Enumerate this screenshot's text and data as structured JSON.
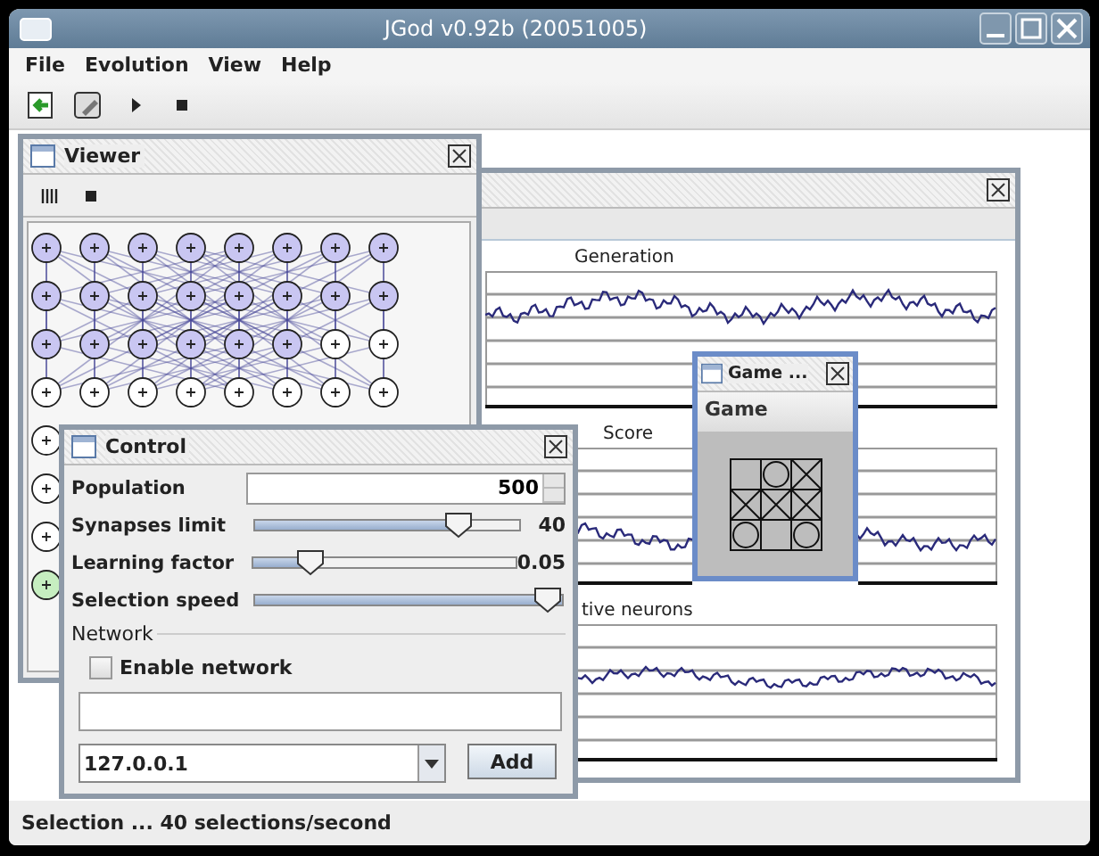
{
  "window": {
    "title": "JGod v0.92b (20051005)"
  },
  "menu": [
    "File",
    "Evolution",
    "View",
    "Help"
  ],
  "viewer": {
    "title": "Viewer",
    "neuron_rows": [
      [
        {
          "active": true,
          "highlighted": false
        },
        {
          "active": true,
          "highlighted": false
        },
        {
          "active": true,
          "highlighted": false
        },
        {
          "active": true,
          "highlighted": false
        },
        {
          "active": true,
          "highlighted": false
        },
        {
          "active": true,
          "highlighted": false
        },
        {
          "active": true,
          "highlighted": false
        },
        {
          "active": true,
          "highlighted": false
        }
      ],
      [
        {
          "active": true,
          "highlighted": false
        },
        {
          "active": true,
          "highlighted": false
        },
        {
          "active": true,
          "highlighted": false
        },
        {
          "active": true,
          "highlighted": false
        },
        {
          "active": true,
          "highlighted": false
        },
        {
          "active": true,
          "highlighted": false
        },
        {
          "active": true,
          "highlighted": false
        },
        {
          "active": true,
          "highlighted": false
        }
      ],
      [
        {
          "active": true,
          "highlighted": false
        },
        {
          "active": true,
          "highlighted": false
        },
        {
          "active": true,
          "highlighted": false
        },
        {
          "active": true,
          "highlighted": false
        },
        {
          "active": true,
          "highlighted": false
        },
        {
          "active": true,
          "highlighted": false
        },
        {
          "active": false,
          "highlighted": false
        },
        {
          "active": false,
          "highlighted": false
        }
      ],
      [
        {
          "active": false,
          "highlighted": false
        },
        {
          "active": false,
          "highlighted": false
        },
        {
          "active": false,
          "highlighted": false
        },
        {
          "active": false,
          "highlighted": false
        },
        {
          "active": false,
          "highlighted": false
        },
        {
          "active": false,
          "highlighted": false
        },
        {
          "active": false,
          "highlighted": false
        },
        {
          "active": false,
          "highlighted": false
        }
      ],
      [
        {
          "active": false,
          "highlighted": false
        }
      ],
      [
        {
          "active": false,
          "highlighted": false
        }
      ],
      [
        {
          "active": false,
          "highlighted": false
        }
      ],
      [
        {
          "active": false,
          "highlighted": true
        }
      ]
    ]
  },
  "stats": {
    "charts": [
      {
        "title": "Generation"
      },
      {
        "title": "Score"
      },
      {
        "title": "tive neurons"
      }
    ]
  },
  "game": {
    "title": "Game ...",
    "heading": "Game",
    "board": [
      [
        {
          "kind": "empty"
        },
        {
          "kind": "o"
        },
        {
          "kind": "x"
        }
      ],
      [
        {
          "kind": "x"
        },
        {
          "kind": "x"
        },
        {
          "kind": "x"
        }
      ],
      [
        {
          "kind": "o"
        },
        {
          "kind": "empty"
        },
        {
          "kind": "o"
        }
      ]
    ]
  },
  "control": {
    "title": "Control",
    "rows": [
      {
        "kind": "spinner",
        "label": "Population",
        "value": "500"
      },
      {
        "kind": "slider",
        "label": "Synapses limit",
        "level": 0.8,
        "reading": "40"
      },
      {
        "kind": "slider",
        "label": "Learning factor",
        "level": 0.18,
        "reading": "0.05"
      },
      {
        "kind": "slider",
        "label": "Selection speed",
        "level": 1
      }
    ],
    "network": {
      "title": "Network",
      "checkbox": {
        "label": "Enable network",
        "checked": false
      },
      "host": "127.0.0.1",
      "button": "Add"
    }
  },
  "status_bar": "Selection ... 40 selections/second"
}
